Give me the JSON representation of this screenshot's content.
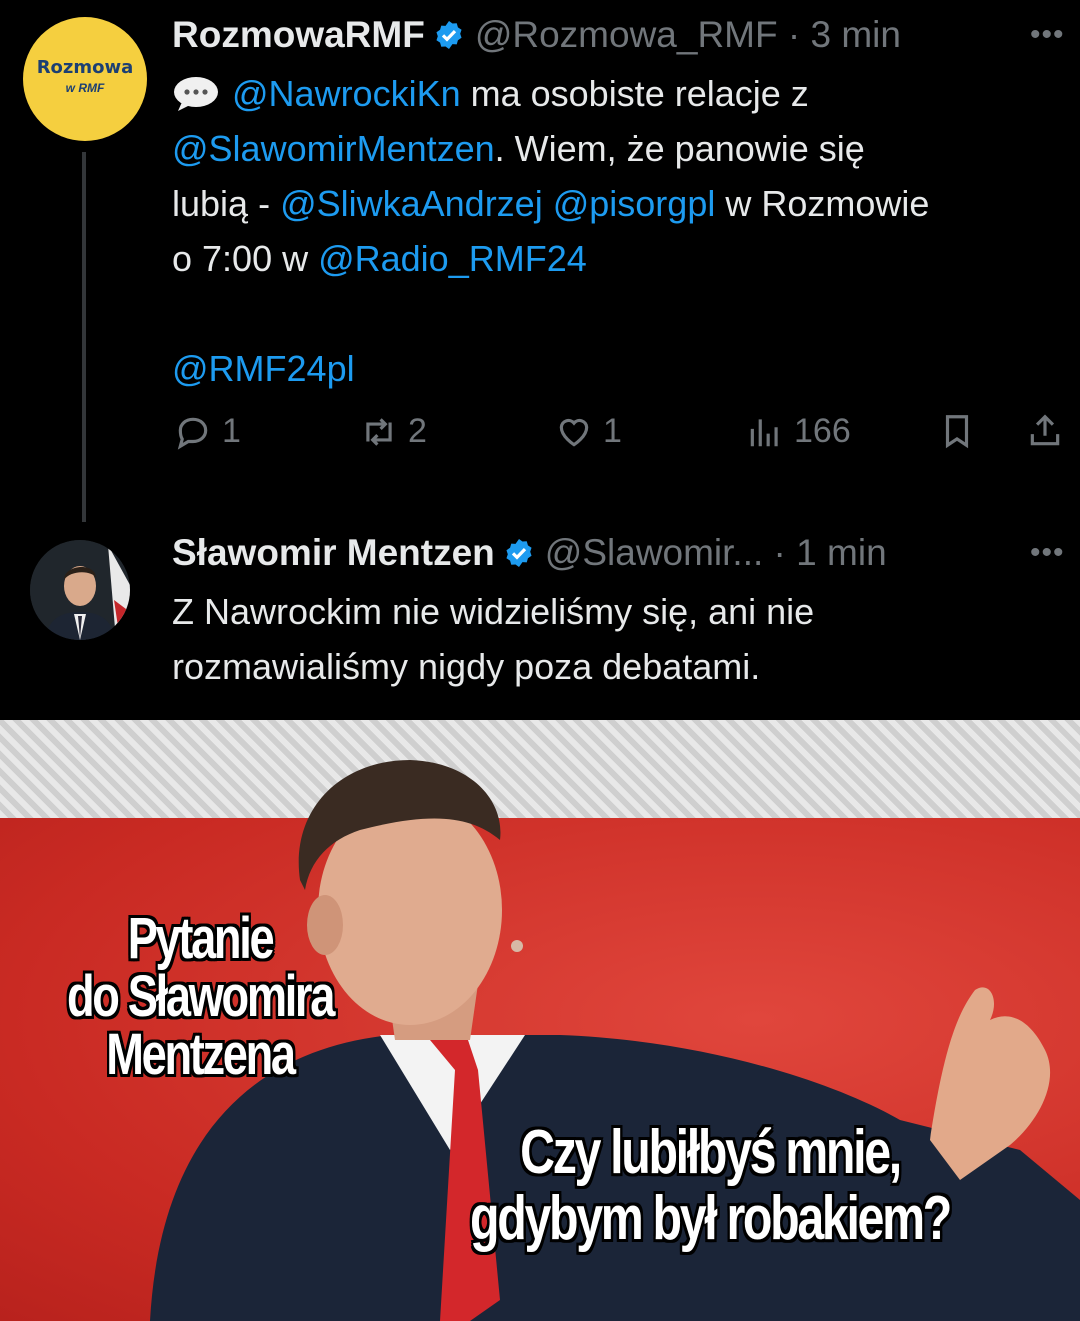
{
  "tweet1": {
    "avatar_line1": "Rozmowa",
    "avatar_line2": "w RMF",
    "name": "RozmowaRMF",
    "handle": "@Rozmowa_RMF",
    "time": "3 min",
    "mention_nawrocki": "@NawrockiKn",
    "text_1": " ma osobiste relacje z",
    "mention_mentzen": "@SlawomirMentzen",
    "text_2": ". Wiem, że panowie się",
    "text_3": "lubią - ",
    "mention_sliwka": "@SliwkaAndrzej",
    "mention_pis": "@pisorgpl",
    "text_4": " w Rozmowie",
    "text_5": "o 7:00 w ",
    "mention_radio": "@Radio_RMF24",
    "mention_rmf24": "@RMF24pl",
    "replies": "1",
    "retweets": "2",
    "likes": "1",
    "views": "166"
  },
  "tweet2": {
    "name": "Sławomir Mentzen",
    "handle": "@Slawomir...",
    "time": "1 min",
    "text_1": "Z Nawrockim nie widzieliśmy się, ani nie",
    "text_2": "rozmawialiśmy nigdy poza debatami."
  },
  "meme": {
    "caption_left_1": "Pytanie",
    "caption_left_2": "do Sławomira",
    "caption_left_3": "Mentzena",
    "caption_right_1": "Czy lubiłbyś mnie,",
    "caption_right_2": "gdybym był robakiem?"
  },
  "colors": {
    "accent": "#1d9bf0",
    "muted": "#71767b",
    "avatar_yellow": "#f5cf3f",
    "meme_red": "#d8312b"
  }
}
